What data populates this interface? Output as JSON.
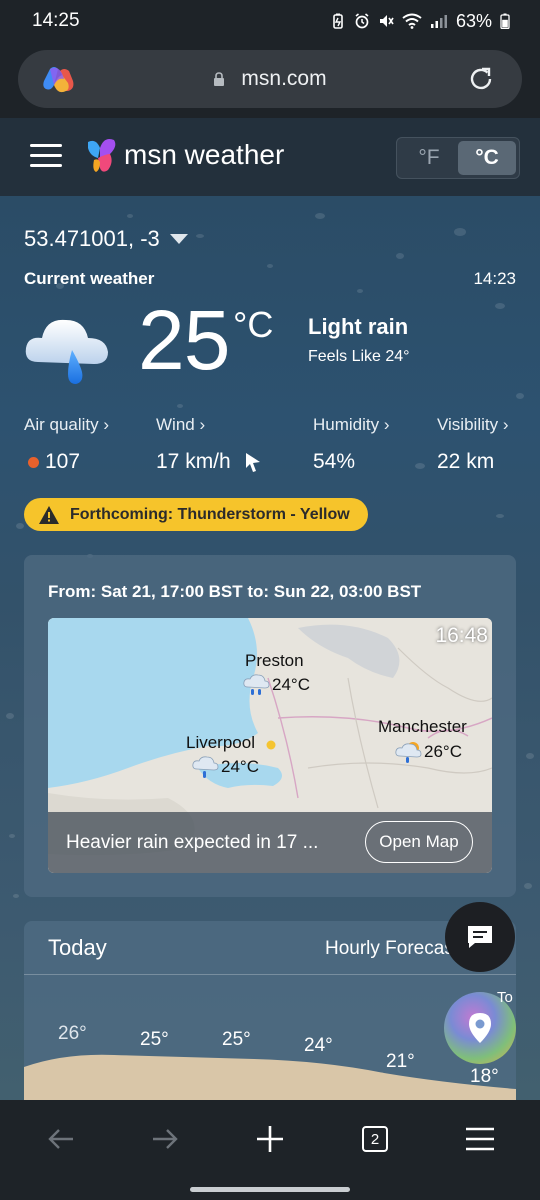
{
  "status_bar": {
    "time": "14:25",
    "battery": "63%",
    "icons": [
      "battery-saver-icon",
      "alarm-icon",
      "mute-icon",
      "wifi-icon",
      "signal-icon",
      "battery-icon"
    ]
  },
  "browser": {
    "url": "msn.com",
    "tab_count": "2",
    "icons": [
      "copilot-icon",
      "lock-icon",
      "reload-icon",
      "back-icon",
      "forward-icon",
      "new-tab-icon",
      "tabs-icon",
      "menu-icon"
    ]
  },
  "header": {
    "brand": "msn weather",
    "units": [
      "°F",
      "°C"
    ],
    "active_unit": "°C"
  },
  "current": {
    "location": "53.471001, -3",
    "label": "Current weather",
    "time": "14:23",
    "temperature": "25",
    "unit": "°C",
    "condition": "Light rain",
    "feels_like": "Feels Like 24°",
    "metrics": [
      {
        "label": "Air quality",
        "value": "107"
      },
      {
        "label": "Wind",
        "value": "17 km/h"
      },
      {
        "label": "Humidity",
        "value": "54%"
      },
      {
        "label": "Visibility",
        "value": "22 km"
      }
    ],
    "alert": "Forthcoming: Thunderstorm - Yellow"
  },
  "map_card": {
    "range": "From: Sat 21, 17:00 BST to: Sun 22, 03:00 BST",
    "map_time": "16:48",
    "cities": [
      {
        "name": "Preston",
        "temp": "24°C"
      },
      {
        "name": "Liverpool",
        "temp": "24°C"
      },
      {
        "name": "Manchester",
        "temp": "26°C"
      }
    ],
    "footer_text": "Heavier rain expected in 17 ...",
    "open_map": "Open Map"
  },
  "today": {
    "title": "Today",
    "hourly_title": "Hourly Forecast",
    "temps": [
      "26°",
      "25°",
      "25°",
      "24°",
      "21°",
      "18°"
    ],
    "partial": "To"
  },
  "colors": {
    "alert_yellow": "#f6c42b",
    "aq_dot": "#e8612c",
    "header_bg": "#23303c"
  }
}
